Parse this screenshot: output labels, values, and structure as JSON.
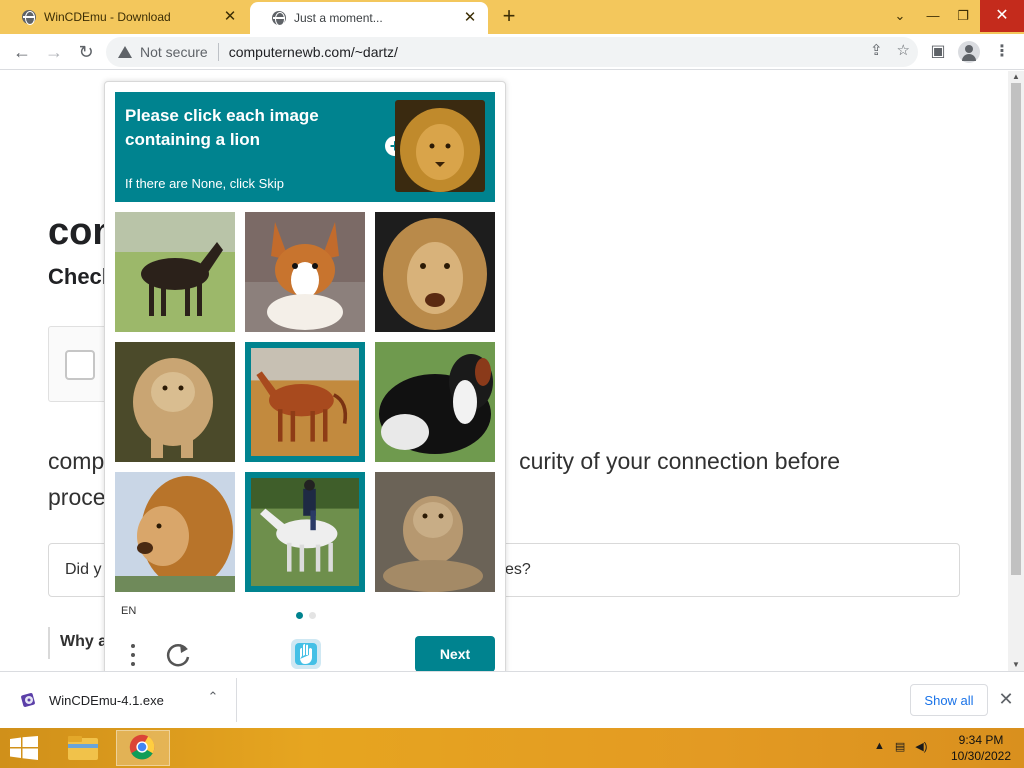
{
  "browser": {
    "tabs": [
      {
        "title": "WinCDEmu - Download",
        "active": false
      },
      {
        "title": "Just a moment...",
        "active": true
      }
    ],
    "new_tab": "+",
    "controls": {
      "dropdown": "⌄",
      "minimize": "—",
      "restore": "❐",
      "close": "✕"
    },
    "nav": {
      "back": "←",
      "forward": "→",
      "reload": "↻"
    },
    "security_label": "Not secure",
    "url": "computernewb.com/~dartz/"
  },
  "page": {
    "heading_fragment": "con",
    "subheading_fragment": "Check",
    "body_left_line1": "comp",
    "body_right_line1": "curity of your connection before",
    "body_left_line2": "proce",
    "faq_left": "Did y",
    "faq_right": "ites?",
    "why_fragment": "Why a"
  },
  "captcha": {
    "prompt_title": "Please click each image containing a lion",
    "prompt_subtitle": "If there are None, click Skip",
    "prompt_plus": "+",
    "tiles": [
      {
        "name": "horse-dark",
        "selected": false
      },
      {
        "name": "corgi",
        "selected": false
      },
      {
        "name": "lion-face",
        "selected": false
      },
      {
        "name": "lion-cub",
        "selected": false
      },
      {
        "name": "horse-brown",
        "selected": true
      },
      {
        "name": "dog-collie",
        "selected": false
      },
      {
        "name": "lion-side",
        "selected": false
      },
      {
        "name": "horse-white-rider",
        "selected": true
      },
      {
        "name": "lioness",
        "selected": false
      }
    ],
    "language": "EN",
    "page_index": 1,
    "page_count": 2,
    "next_label": "Next",
    "accent_color": "#00838f"
  },
  "downloads": {
    "filename": "WinCDEmu-4.1.exe",
    "caret": "⌃",
    "show_all_label": "Show all",
    "close": "✕"
  },
  "taskbar": {
    "tray_arrow": "▲",
    "time": "9:34 PM",
    "date": "10/30/2022"
  }
}
